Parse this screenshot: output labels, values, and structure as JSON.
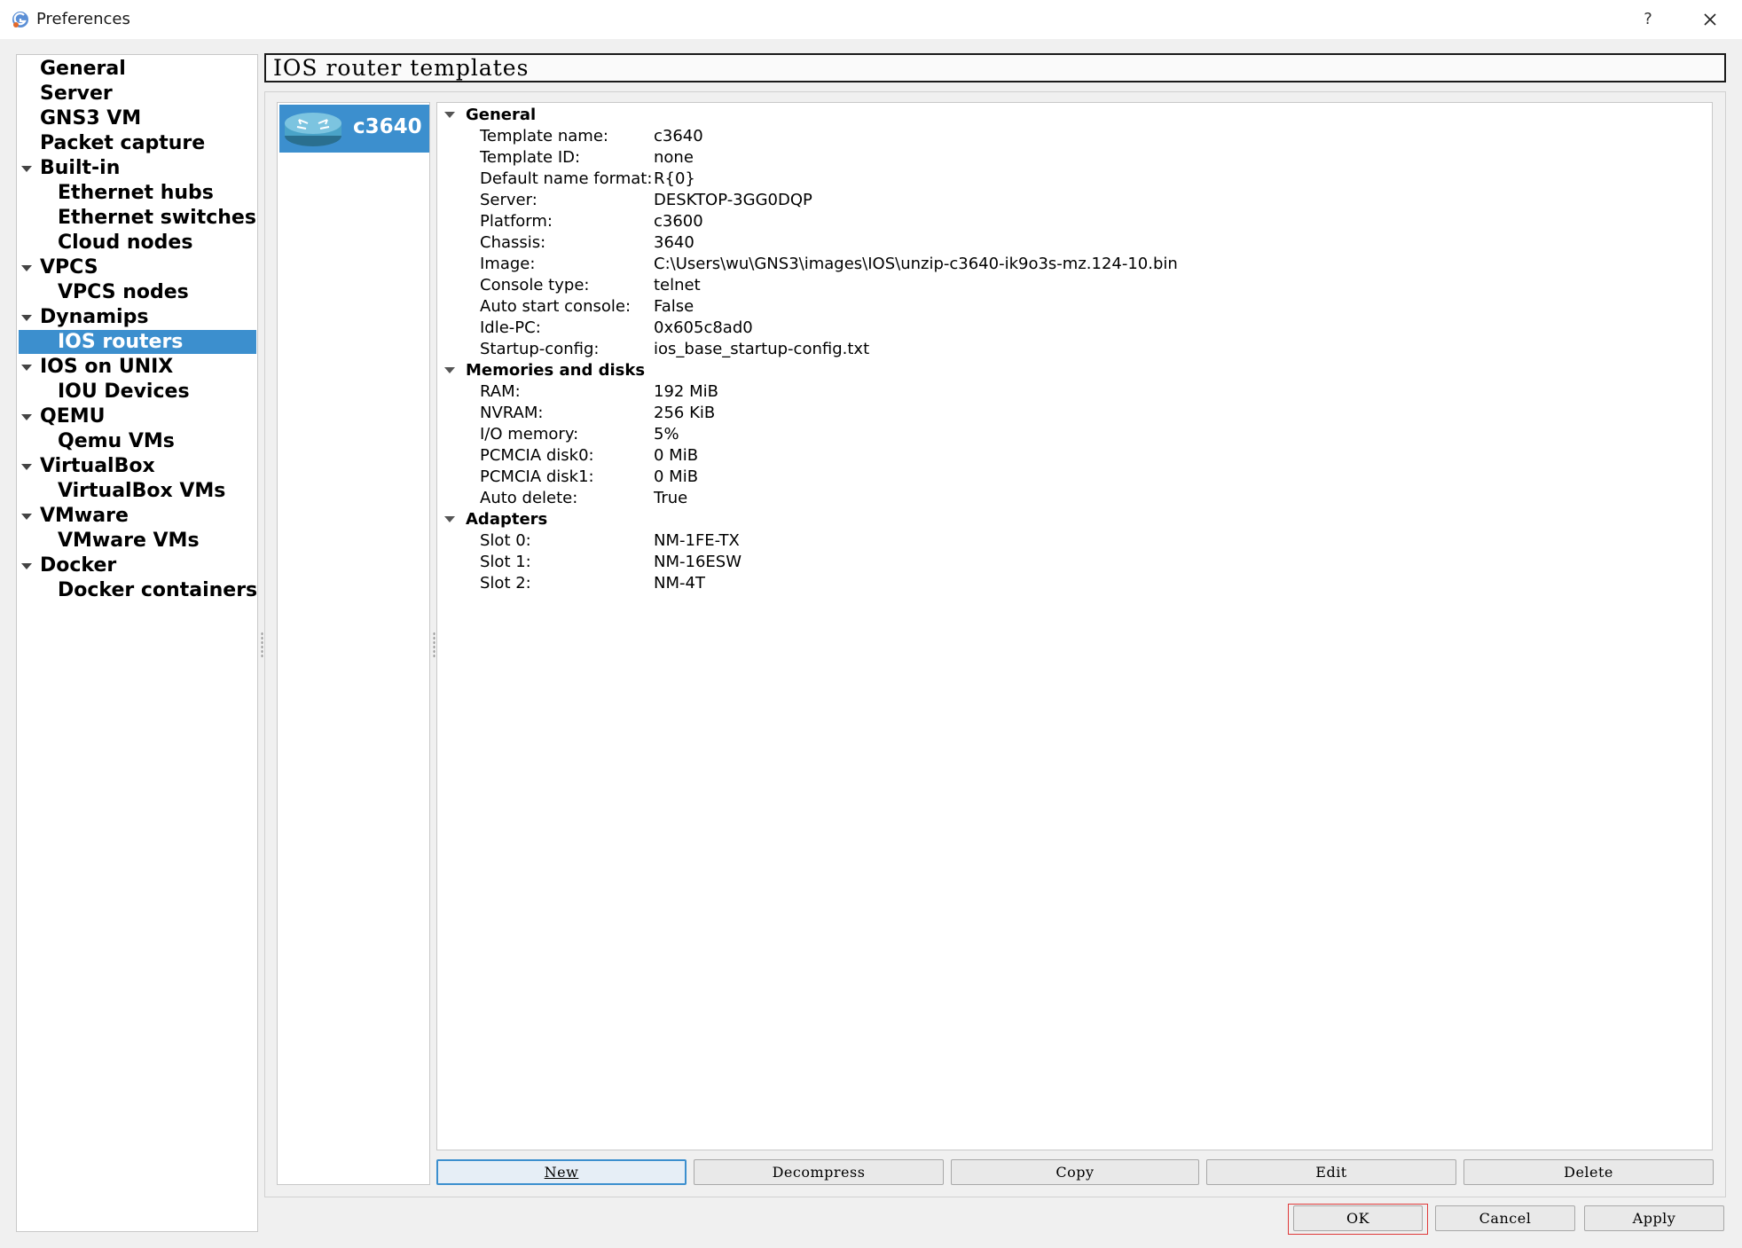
{
  "window": {
    "title": "Preferences",
    "help_label": "?",
    "app_icon": "gns3-icon",
    "close_icon": "close-icon"
  },
  "nav": {
    "items": [
      {
        "label": "General",
        "level": 0,
        "expandable": false
      },
      {
        "label": "Server",
        "level": 0,
        "expandable": false
      },
      {
        "label": "GNS3 VM",
        "level": 0,
        "expandable": false
      },
      {
        "label": "Packet capture",
        "level": 0,
        "expandable": false
      },
      {
        "label": "Built-in",
        "level": 0,
        "expandable": true
      },
      {
        "label": "Ethernet hubs",
        "level": 1,
        "expandable": false
      },
      {
        "label": "Ethernet switches",
        "level": 1,
        "expandable": false
      },
      {
        "label": "Cloud nodes",
        "level": 1,
        "expandable": false
      },
      {
        "label": "VPCS",
        "level": 0,
        "expandable": true
      },
      {
        "label": "VPCS nodes",
        "level": 1,
        "expandable": false
      },
      {
        "label": "Dynamips",
        "level": 0,
        "expandable": true
      },
      {
        "label": "IOS routers",
        "level": 1,
        "expandable": false,
        "selected": true
      },
      {
        "label": "IOS on UNIX",
        "level": 0,
        "expandable": true
      },
      {
        "label": "IOU Devices",
        "level": 1,
        "expandable": false
      },
      {
        "label": "QEMU",
        "level": 0,
        "expandable": true
      },
      {
        "label": "Qemu VMs",
        "level": 1,
        "expandable": false
      },
      {
        "label": "VirtualBox",
        "level": 0,
        "expandable": true
      },
      {
        "label": "VirtualBox VMs",
        "level": 1,
        "expandable": false
      },
      {
        "label": "VMware",
        "level": 0,
        "expandable": true
      },
      {
        "label": "VMware VMs",
        "level": 1,
        "expandable": false
      },
      {
        "label": "Docker",
        "level": 0,
        "expandable": true
      },
      {
        "label": "Docker containers",
        "level": 1,
        "expandable": false
      }
    ]
  },
  "page": {
    "title": "IOS router templates"
  },
  "templates": [
    {
      "name": "c3640",
      "icon": "router-icon",
      "selected": true
    }
  ],
  "details": {
    "sections": [
      {
        "label": "General",
        "rows": [
          {
            "key": "Template name:",
            "value": "c3640"
          },
          {
            "key": "Template ID:",
            "value": "none"
          },
          {
            "key": "Default name format:",
            "value": "R{0}"
          },
          {
            "key": "Server:",
            "value": "DESKTOP-3GG0DQP"
          },
          {
            "key": "Platform:",
            "value": "c3600"
          },
          {
            "key": "Chassis:",
            "value": "3640"
          },
          {
            "key": "Image:",
            "value": "C:\\Users\\wu\\GNS3\\images\\IOS\\unzip-c3640-ik9o3s-mz.124-10.bin"
          },
          {
            "key": "Console type:",
            "value": "telnet"
          },
          {
            "key": "Auto start console:",
            "value": "False"
          },
          {
            "key": "Idle-PC:",
            "value": "0x605c8ad0"
          },
          {
            "key": "Startup-config:",
            "value": "ios_base_startup-config.txt"
          }
        ]
      },
      {
        "label": "Memories and disks",
        "rows": [
          {
            "key": "RAM:",
            "value": "192 MiB"
          },
          {
            "key": "NVRAM:",
            "value": "256 KiB"
          },
          {
            "key": "I/O memory:",
            "value": "5%"
          },
          {
            "key": "PCMCIA disk0:",
            "value": "0 MiB"
          },
          {
            "key": "PCMCIA disk1:",
            "value": "0 MiB"
          },
          {
            "key": "Auto delete:",
            "value": "True"
          }
        ]
      },
      {
        "label": "Adapters",
        "rows": [
          {
            "key": "Slot 0:",
            "value": "NM-1FE-TX"
          },
          {
            "key": "Slot 1:",
            "value": "NM-16ESW"
          },
          {
            "key": "Slot 2:",
            "value": "NM-4T"
          }
        ]
      }
    ]
  },
  "actions": {
    "new_label": "New",
    "decompress_label": "Decompress",
    "copy_label": "Copy",
    "edit_label": "Edit",
    "delete_label": "Delete"
  },
  "dialog_buttons": {
    "ok_label": "OK",
    "cancel_label": "Cancel",
    "apply_label": "Apply"
  },
  "colors": {
    "selection": "#3c8fce",
    "highlight_outline": "#e03a3a"
  }
}
